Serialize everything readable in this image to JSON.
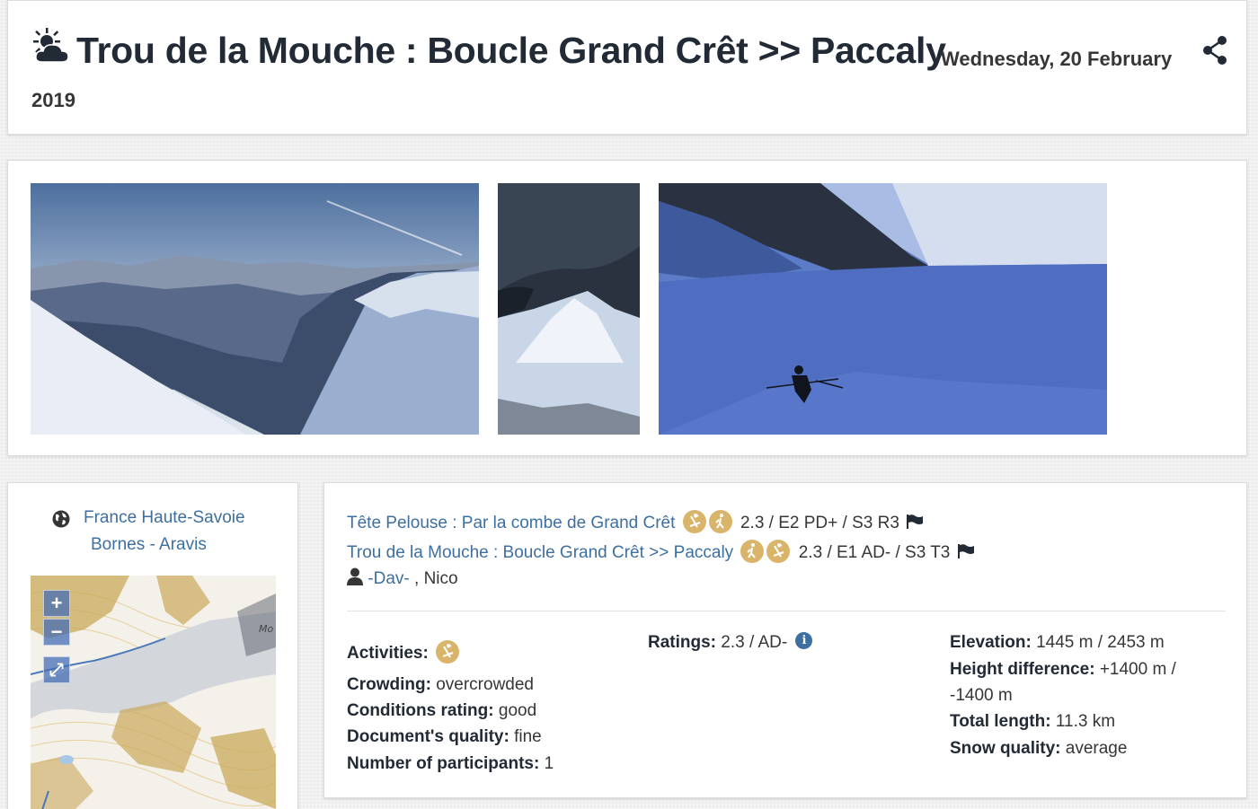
{
  "header": {
    "weather_icon": "sun-behind-cloud-icon",
    "title": "Trou de la Mouche : Boucle Grand Crêt >> Paccaly",
    "date_part1": "Wednesday, 20 February",
    "date_part2": "2019",
    "share_icon": "share-icon"
  },
  "photos": [
    {
      "name": "photo-snowy-ridge-panorama"
    },
    {
      "name": "photo-rocky-peak-cave-view"
    },
    {
      "name": "photo-skier-descending-slope"
    }
  ],
  "location": {
    "icon": "globe-icon",
    "country": "France",
    "region": "Haute-Savoie",
    "range": "Bornes - Aravis",
    "map": {
      "zoom_in": "+",
      "zoom_out": "−",
      "fullscreen_icon": "expand-icon",
      "label": "Mo"
    }
  },
  "routes": [
    {
      "name": "Tête Pelouse : Par la combe de Grand Crêt",
      "activity_icons": [
        "skitouring-icon",
        "snowshoeing-icon"
      ],
      "rating": "2.3 / E2 PD+ / S3 R3"
    },
    {
      "name": "Trou de la Mouche : Boucle Grand Crêt >> Paccaly",
      "activity_icons": [
        "snowshoeing-icon",
        "skitouring-icon"
      ],
      "rating": "2.3 / E1 AD- / S3 T3"
    }
  ],
  "participants": {
    "linked": "-Dav-",
    "separator": " , ",
    "other": "Nico"
  },
  "facts": {
    "activities_label": "Activities:",
    "crowding_label": "Crowding:",
    "crowding_value": "overcrowded",
    "conditions_label": "Conditions rating:",
    "conditions_value": "good",
    "quality_label": "Document's quality:",
    "quality_value": "fine",
    "participants_label": "Number of participants:",
    "participants_value": "1",
    "ratings_label": "Ratings:",
    "ratings_value": "2.3 / AD-",
    "elevation_label": "Elevation:",
    "elevation_value": "1445 m / 2453 m",
    "height_diff_label": "Height difference:",
    "height_diff_value_1": "+1400 m /",
    "height_diff_value_2": "-1400 m",
    "length_label": "Total length:",
    "length_value": "11.3 km",
    "snow_label": "Snow quality:",
    "snow_value": "average"
  },
  "colors": {
    "link": "#3d6fa0",
    "activity_badge": "#d8b56a",
    "heading": "#222b35"
  }
}
